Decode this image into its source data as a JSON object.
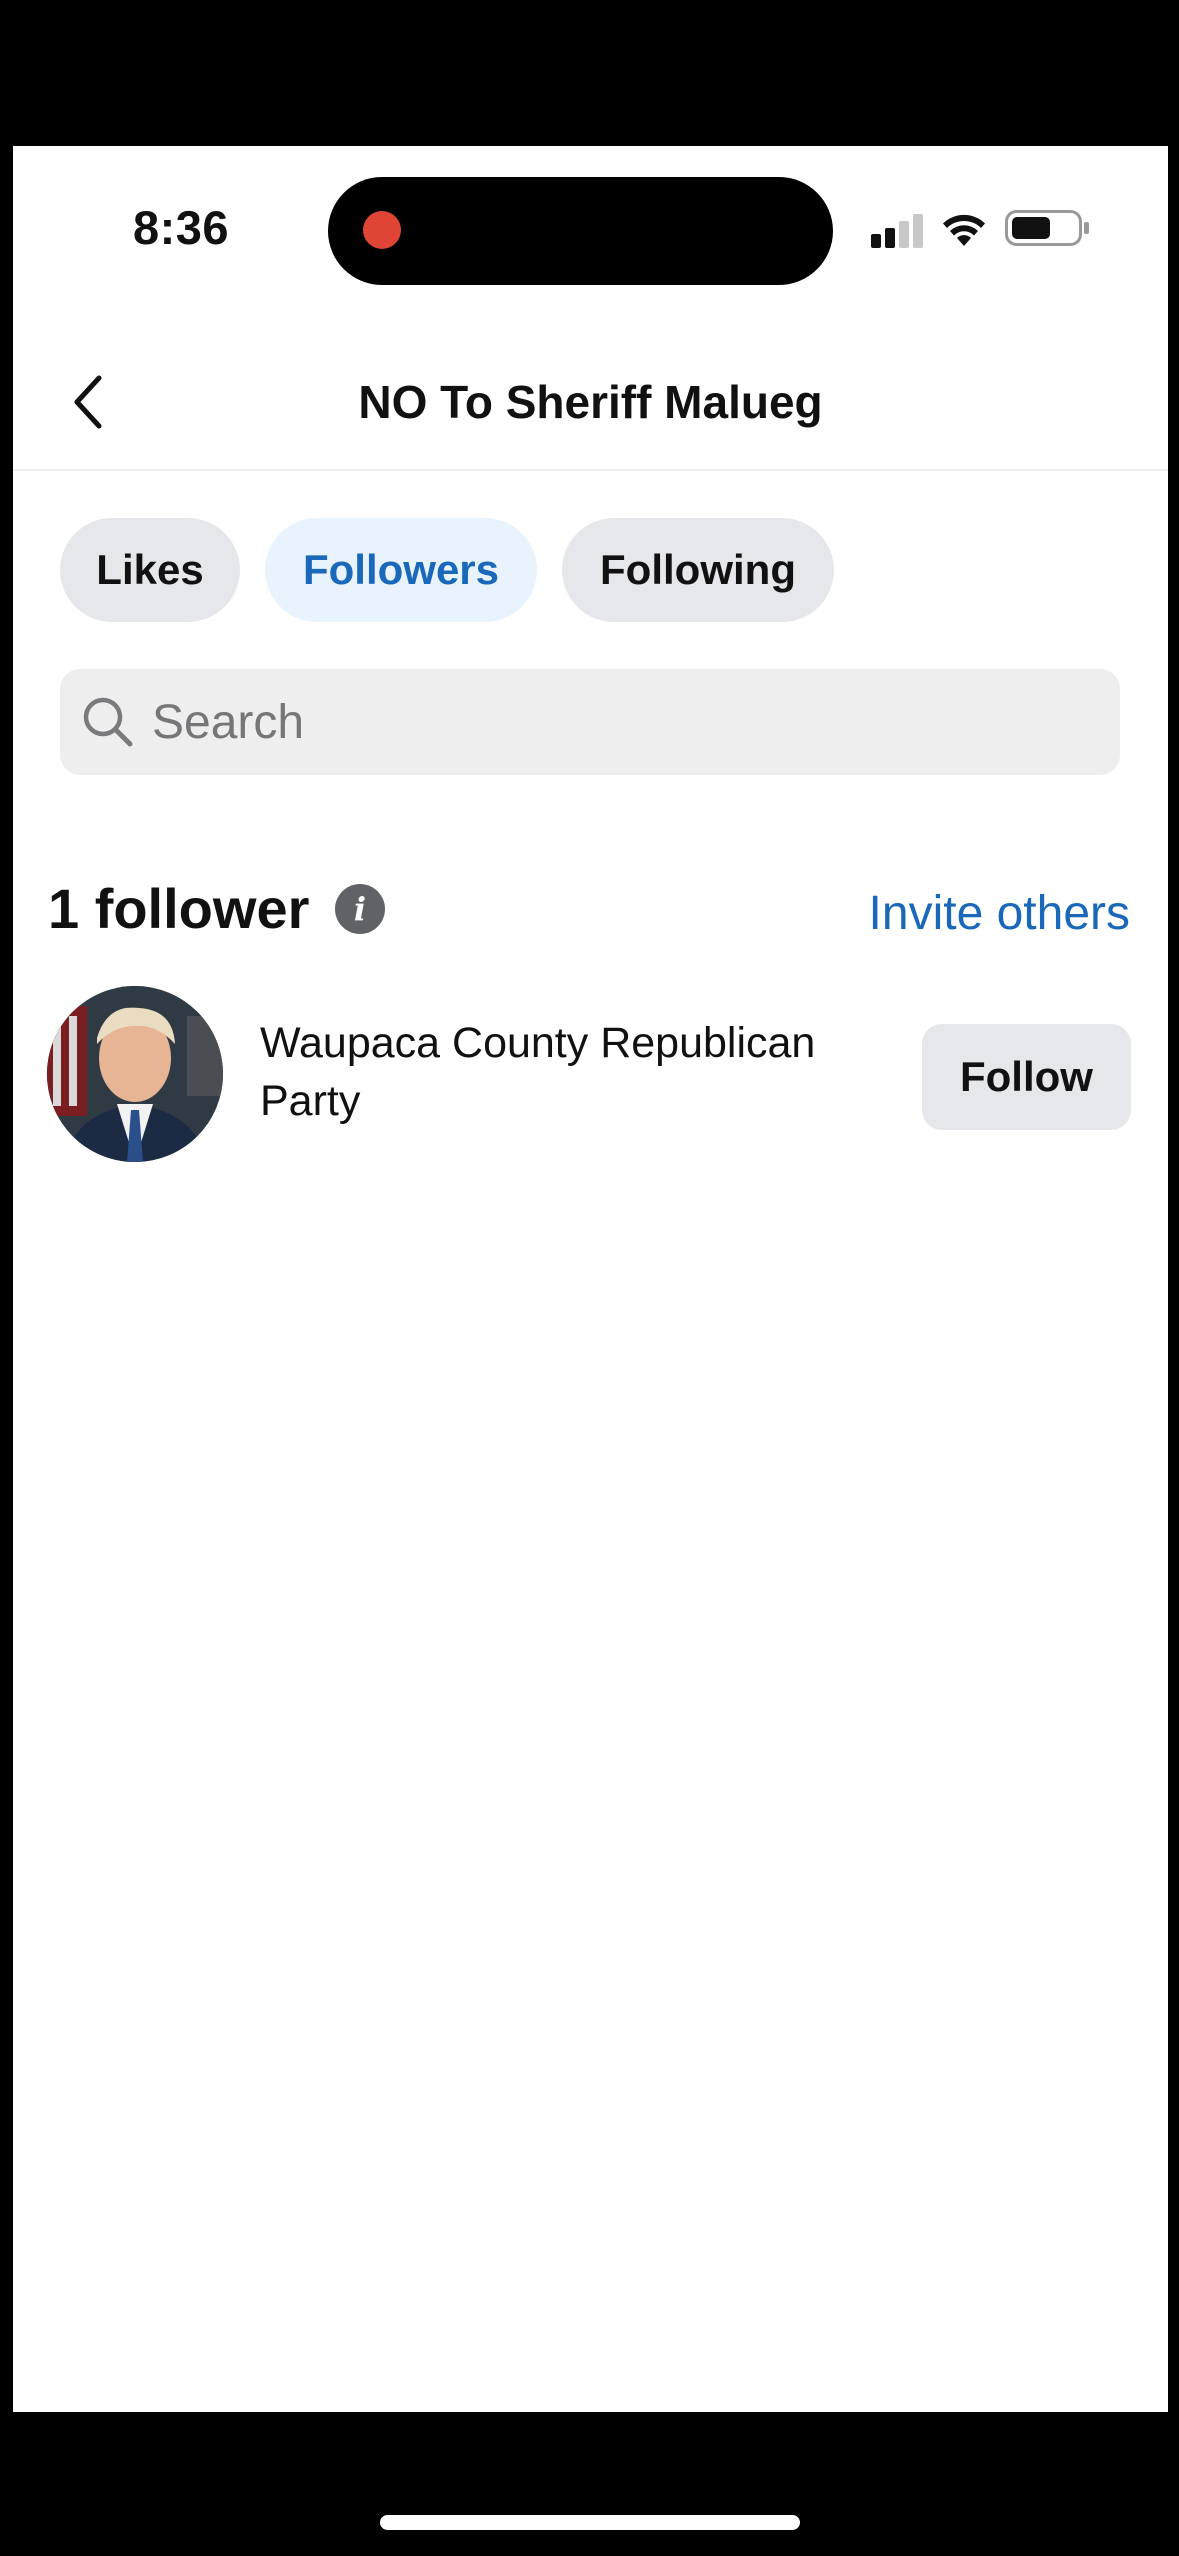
{
  "status_bar": {
    "time": "8:36"
  },
  "header": {
    "title": "NO To Sheriff Malueg"
  },
  "tabs": [
    {
      "label": "Likes",
      "active": false
    },
    {
      "label": "Followers",
      "active": true
    },
    {
      "label": "Following",
      "active": false
    }
  ],
  "search": {
    "placeholder": "Search",
    "value": ""
  },
  "followers_section": {
    "count_label": "1 follower",
    "invite_label": "Invite others"
  },
  "followers": [
    {
      "name": "Waupaca County Republican Party",
      "button_label": "Follow"
    }
  ],
  "icons": {
    "back": "chevron-left-icon",
    "search": "search-icon",
    "info": "info-icon",
    "signal": "cellular-signal-icon",
    "wifi": "wifi-icon",
    "battery": "battery-icon"
  },
  "colors": {
    "accent": "#1a68b9",
    "active_tab_bg": "#e9f3fd",
    "chip_bg": "#e6e7ea",
    "recording": "#e04434"
  }
}
